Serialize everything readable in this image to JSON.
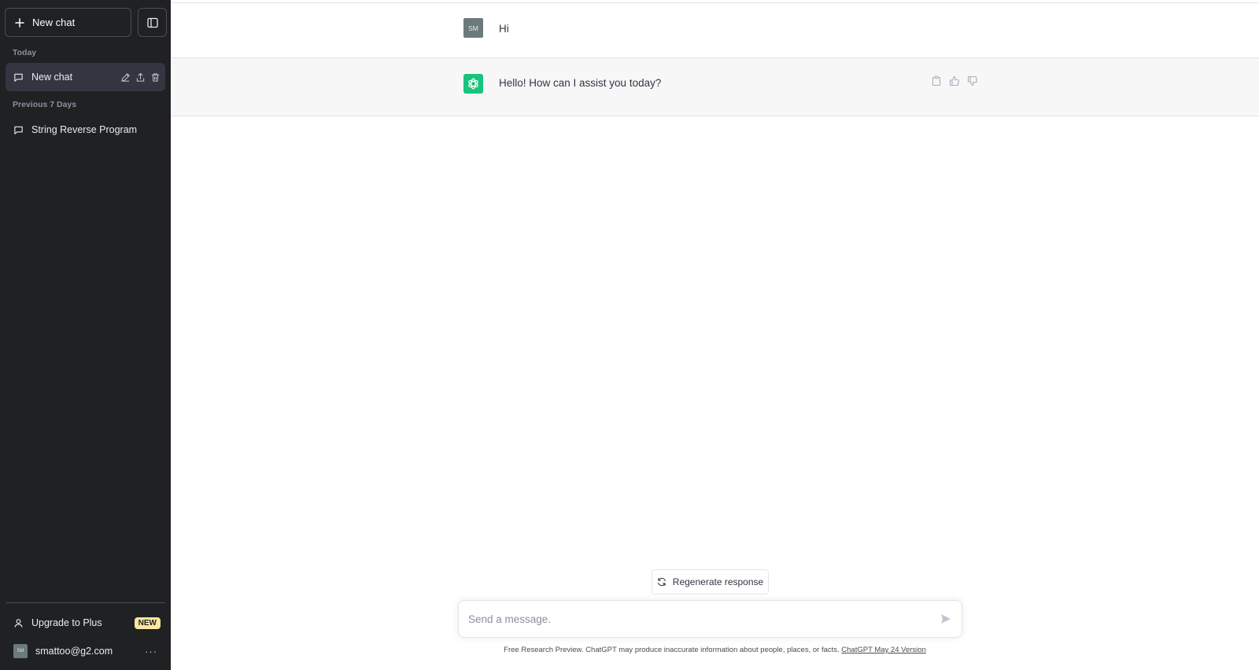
{
  "sidebar": {
    "new_chat_label": "New chat",
    "sections": [
      {
        "label": "Today"
      },
      {
        "label": "Previous 7 Days"
      }
    ],
    "items": [
      {
        "label": "New chat",
        "active": true
      },
      {
        "label": "String Reverse Program",
        "active": false
      }
    ],
    "upgrade_label": "Upgrade to Plus",
    "upgrade_badge": "NEW",
    "user_initials": "SM",
    "user_email": "smattoo@g2.com"
  },
  "conversation": {
    "user_initials": "SM",
    "user_message": "Hi",
    "bot_message": "Hello! How can I assist you today?"
  },
  "composer": {
    "regenerate_label": "Regenerate response",
    "placeholder": "Send a message.",
    "footer_text": "Free Research Preview. ChatGPT may produce inaccurate information about people, places, or facts. ",
    "footer_link": "ChatGPT May 24 Version"
  },
  "colors": {
    "sidebar_bg": "#202123",
    "active_item_bg": "#343541",
    "bot_avatar": "#19c37d",
    "bot_row_bg": "#f7f7f8",
    "badge_bg": "#fae69e"
  },
  "icons": {
    "plus": "plus-icon",
    "sidebar_toggle": "sidebar-toggle-icon",
    "chat": "chat-bubble-icon",
    "edit": "pencil-icon",
    "share": "share-icon",
    "delete": "trash-icon",
    "user": "user-icon",
    "more": "more-dots-icon",
    "copy": "clipboard-icon",
    "thumbs_up": "thumbs-up-icon",
    "thumbs_down": "thumbs-down-icon",
    "regenerate": "refresh-icon",
    "send": "send-icon",
    "openai": "openai-logo-icon"
  }
}
